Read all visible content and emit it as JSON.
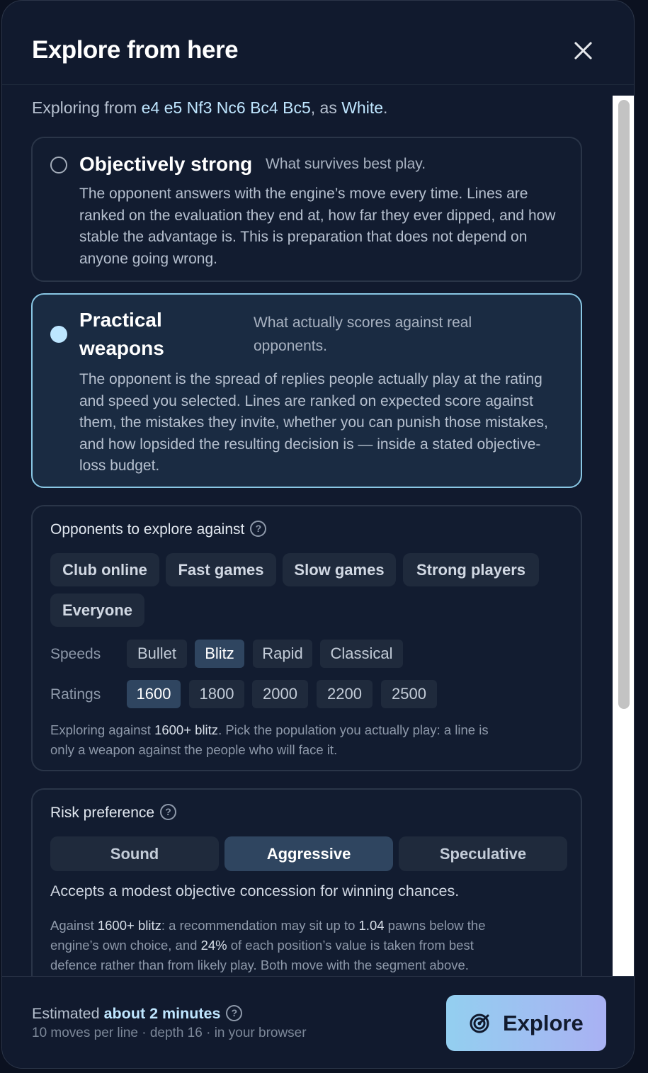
{
  "header": {
    "title": "Explore from here"
  },
  "intro": {
    "prefix": "Exploring from ",
    "moves": "e4 e5 Nf3 Nc6 Bc4 Bc5",
    "middle": ", as ",
    "side": "White",
    "suffix": "."
  },
  "options": [
    {
      "title": "Objectively strong",
      "subtitle": "What survives best play.",
      "description": "The opponent answers with the engine’s move every time. Lines are ranked on the evaluation they end at, how far they ever dipped, and how stable the advantage is. This is preparation that does not depend on anyone going wrong.",
      "selected": false
    },
    {
      "title_line1": "Practical",
      "title_line2": "weapons",
      "subtitle_line1": "What actually scores against real",
      "subtitle_line2": "opponents.",
      "description": "The opponent is the spread of replies people actually play at the rating and speed you selected. Lines are ranked on expected score against them, the mistakes they invite, whether you can punish those mistakes, and how lopsided the resulting decision is — inside a stated objective-loss budget.",
      "selected": true
    }
  ],
  "opponents": {
    "label": "Opponents to explore against",
    "help": "?",
    "presets": [
      "Club online",
      "Fast games",
      "Slow games",
      "Strong players",
      "Everyone"
    ],
    "speeds_label": "Speeds",
    "speeds": [
      "Bullet",
      "Blitz",
      "Rapid",
      "Classical"
    ],
    "speeds_selected": "Blitz",
    "ratings_label": "Ratings",
    "ratings": [
      "1600",
      "1800",
      "2000",
      "2200",
      "2500"
    ],
    "ratings_selected": "1600",
    "note_prefix": "Exploring against ",
    "note_pop": "1600+ blitz",
    "note_line1_rest": ". Pick the population you actually play: a line is",
    "note_line2": "only a weapon against the people who will face it."
  },
  "risk": {
    "label": "Risk preference",
    "help": "?",
    "options": [
      "Sound",
      "Aggressive",
      "Speculative"
    ],
    "selected": "Aggressive",
    "description": "Accepts a modest objective concession for winning chances.",
    "n1": "Against ",
    "n2": "1600+ blitz",
    "n3": ": a recommendation may sit up to ",
    "n4": "1.04",
    "n5": " pawns below the",
    "n6": "engine’s own choice, and ",
    "n7": "24%",
    "n8": " of each position’s value is taken from best",
    "n9": "defence rather than from likely play. Both move with the segment above."
  },
  "footer": {
    "estimated_label": "Estimated",
    "estimated_value": "about 2 minutes",
    "help": "?",
    "details": "10 moves per line · depth 16 · in your browser",
    "button_label": "Explore",
    "button_icon": "radar-icon"
  },
  "colors": {
    "accent": "#bfe6ff",
    "panel": "#111a2e",
    "selected_border": "#89c7e4"
  }
}
